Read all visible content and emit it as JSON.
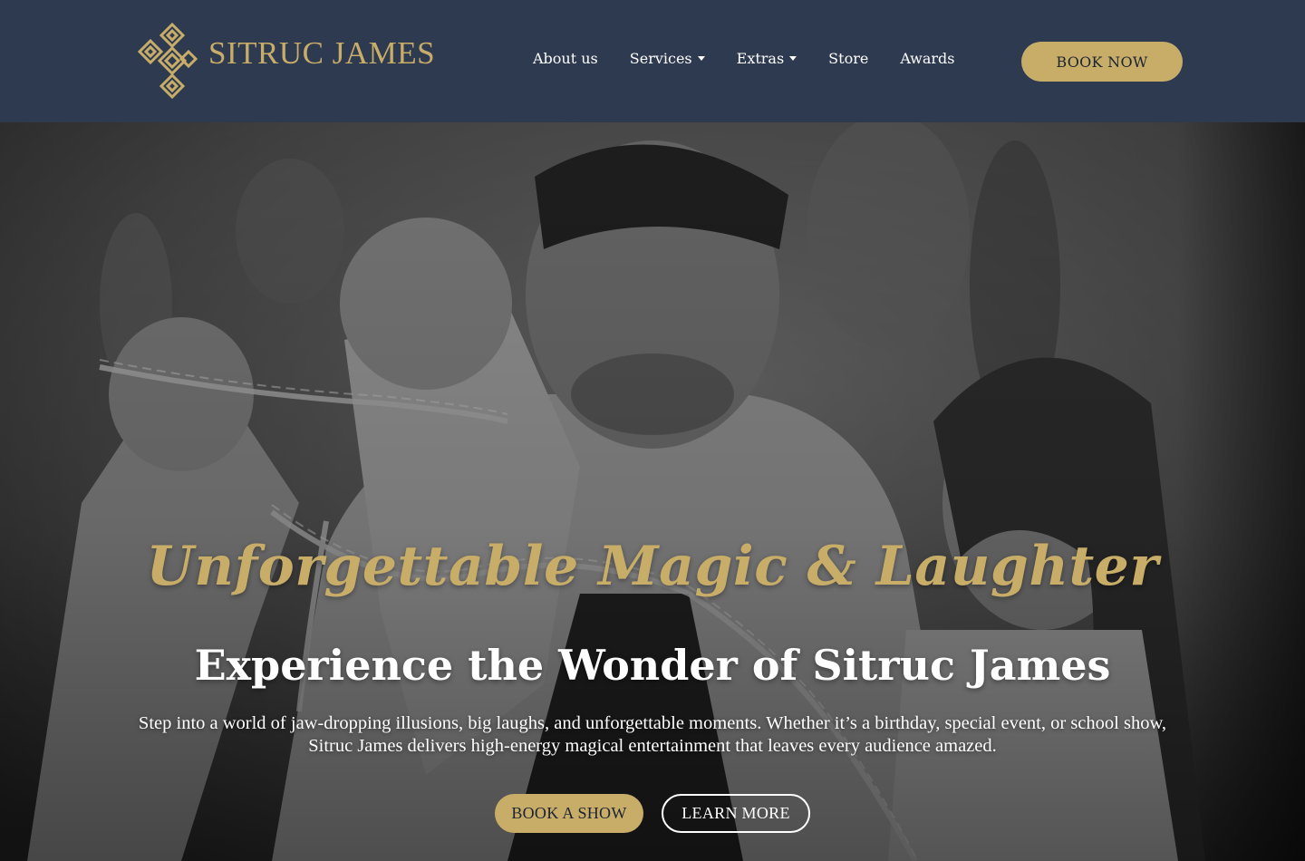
{
  "brand": {
    "name": "SITRUC JAMES",
    "logo_icon": "gold-diamond-lattice-icon",
    "accent_color": "#c8ad69",
    "header_bg": "#2e3a50"
  },
  "nav": {
    "items": [
      {
        "label": "About us",
        "has_dropdown": false
      },
      {
        "label": "Services",
        "has_dropdown": true
      },
      {
        "label": "Extras",
        "has_dropdown": true
      },
      {
        "label": "Store",
        "has_dropdown": false
      },
      {
        "label": "Awards",
        "has_dropdown": false
      }
    ],
    "cta_label": "BOOK NOW"
  },
  "hero": {
    "image": "grayscale-photo-magician-in-chains",
    "title": "Unforgettable Magic & Laughter",
    "subtitle": "Experience the Wonder of Sitruc James",
    "description": "Step into a world of jaw-dropping illusions, big laughs, and unforgettable moments. Whether it’s a birthday, special event, or school show, Sitruc James delivers high-energy magical entertainment that leaves every audience amazed.",
    "primary_button": "BOOK A SHOW",
    "secondary_button": "LEARN MORE"
  }
}
